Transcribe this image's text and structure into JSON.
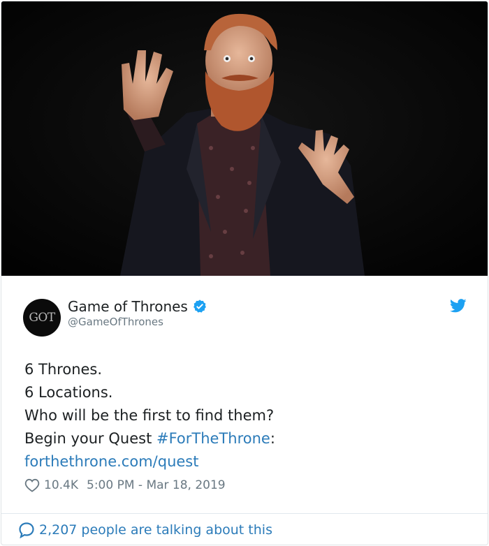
{
  "media": {
    "alt": "Bearded man in dark blazer raising both hands"
  },
  "author": {
    "avatar_text": "GOT",
    "display_name": "Game of Thrones",
    "handle": "@GameOfThrones",
    "verified": true,
    "verified_icon": "verified-badge-icon",
    "platform_icon": "twitter-bird-icon"
  },
  "tweet": {
    "line1": "6 Thrones.",
    "line2": "6 Locations.",
    "line3": "Who will be the first to find them?",
    "line4_prefix": "Begin your Quest ",
    "hashtag": "#ForTheThrone",
    "line4_suffix": ":",
    "url": "forthethrone.com/quest"
  },
  "meta": {
    "likes": "10.4K",
    "timestamp": "5:00 PM - Mar 18, 2019"
  },
  "footer": {
    "talking_label": "2,207 people are talking about this"
  },
  "colors": {
    "link": "#2b7bb9",
    "verified": "#1da1f2",
    "text": "#1c2022",
    "muted": "#697882"
  }
}
